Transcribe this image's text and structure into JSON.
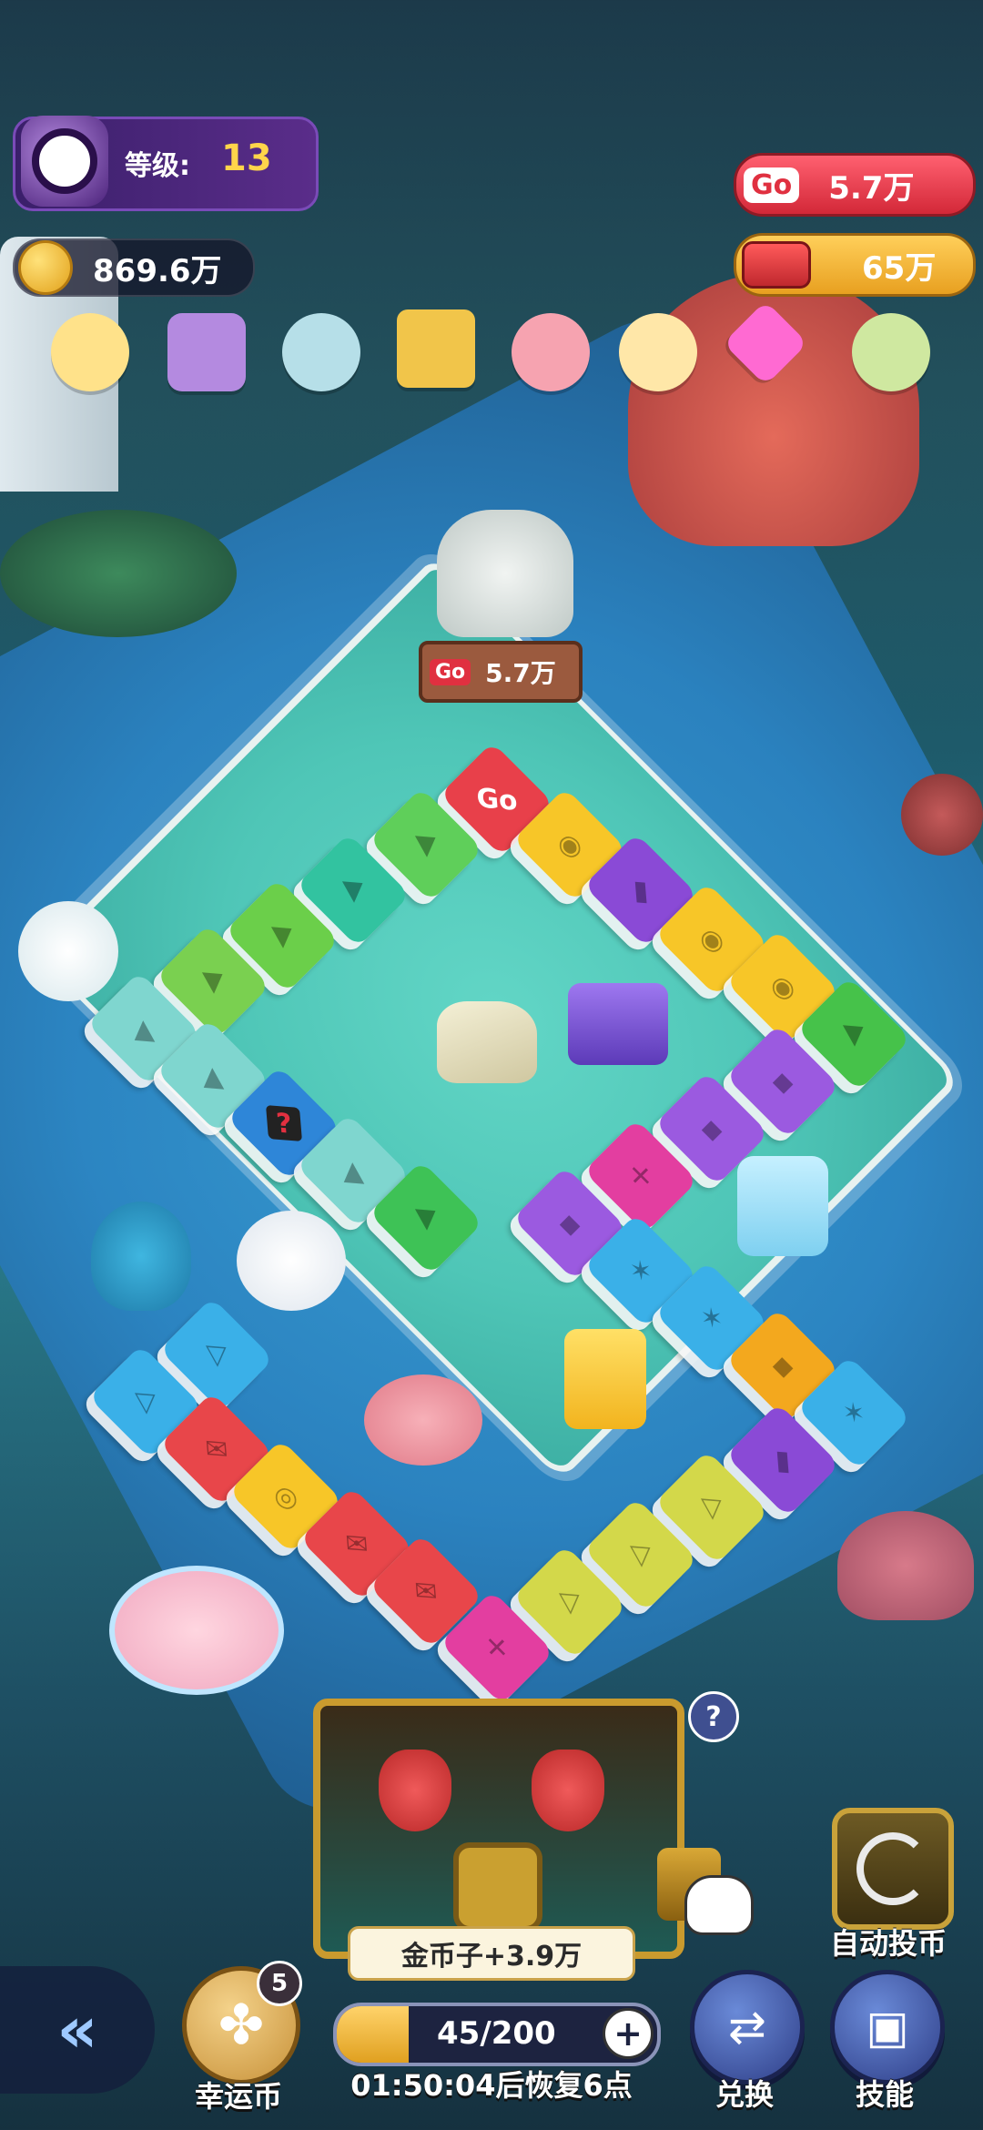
{
  "hud": {
    "level_label": "等级:",
    "level_value": "13",
    "coins": "869.6万",
    "go_badge": "Go",
    "go_amount": "5.7万",
    "crown_amount": "65万"
  },
  "board": {
    "sign_badge": "Go",
    "sign_amount": "5.7万",
    "start_tile": "Go",
    "mystery_tile": "?"
  },
  "chest": {
    "help": "?",
    "reward_text": "金币子+3.9万"
  },
  "bottom": {
    "lucky_badge": "5",
    "lucky_label": "幸运币",
    "energy": "45/200",
    "energy_fill_fraction": 0.225,
    "plus": "+",
    "recovery_text": "01:50:04后恢复6点",
    "auto_label": "自动投币",
    "exchange_label": "兑换",
    "skill_label": "技能"
  },
  "icons": [
    "back-arrow-icon",
    "clover-icon",
    "plus-icon",
    "question-icon",
    "refresh-icon",
    "exchange-icon",
    "skill-card-icon",
    "gold-coin-icon",
    "go-icon",
    "crown-icon"
  ],
  "colors": {
    "go_red": "#e03040",
    "coin_gold": "#f3b52a",
    "hud_purple": "#5a2d8a"
  }
}
